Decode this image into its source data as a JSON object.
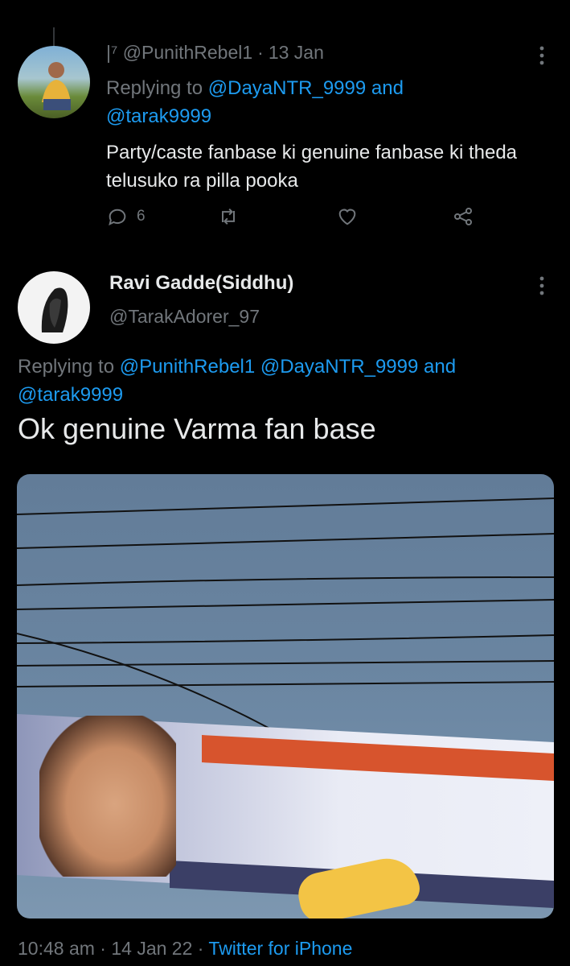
{
  "tweet1": {
    "display_name": "|⁷",
    "handle": "@PunithRebel1",
    "date": "13 Jan",
    "replying_prefix": "Replying to",
    "replying_mention1": "@DayaNTR_9999",
    "replying_and": "and",
    "replying_mention2": "@tarak9999",
    "text": "Party/caste fanbase ki genuine fanbase ki theda telusuko ra pilla pooka",
    "reply_count": "6"
  },
  "tweet2": {
    "display_name": "Ravi Gadde(Siddhu)",
    "handle": "@TarakAdorer_97",
    "replying_prefix": "Replying to",
    "replying_mention1": "@PunithRebel1",
    "replying_mention2": "@DayaNTR_9999",
    "replying_and": "and",
    "replying_mention3": "@tarak9999",
    "text": "Ok genuine Varma fan base",
    "time": "10:48 am",
    "date": "14 Jan 22",
    "source": "Twitter for iPhone"
  },
  "icons": {
    "more": "more-vertical-icon",
    "reply": "reply-icon",
    "retweet": "retweet-icon",
    "like": "heart-icon",
    "share": "share-icon"
  },
  "colors": {
    "accent": "#1d9bf0",
    "muted": "#71767b",
    "background": "#000000"
  }
}
